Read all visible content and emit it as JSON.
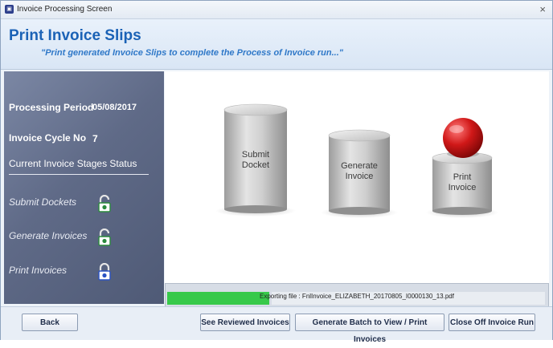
{
  "window": {
    "title": "Invoice Processing Screen",
    "app_icon": "app-icon",
    "close_glyph": "×"
  },
  "header": {
    "title": "Print Invoice Slips",
    "subtitle": "\"Print generated Invoice Slips to complete the Process of Invoice run...\""
  },
  "sidebar": {
    "processing_period_label": "Processing Period",
    "processing_period_value": "05/08/2017",
    "invoice_cycle_label": "Invoice Cycle No",
    "invoice_cycle_value": "7",
    "status_heading": "Current Invoice Stages Status",
    "stages": [
      {
        "label": "Submit Dockets",
        "icon": "unlocked-padlock-icon",
        "color": "#2a8a3c"
      },
      {
        "label": "Generate Invoices",
        "icon": "unlocked-padlock-icon",
        "color": "#2a8a3c"
      },
      {
        "label": "Print Invoices",
        "icon": "locked-padlock-icon",
        "color": "#2a53c4"
      }
    ]
  },
  "diagram": {
    "stages": [
      {
        "line1": "Submit",
        "line2": "Docket"
      },
      {
        "line1": "Generate",
        "line2": "Invoice"
      },
      {
        "line1": "Print",
        "line2": "Invoice"
      }
    ],
    "current_stage_marker": "red-ball-indicator",
    "marker_color": "#d01818"
  },
  "progress": {
    "text": "Exporting file : FnlInvoice_ELIZABETH_20170805_I0000130_13.pdf",
    "fraction": 0.27,
    "color": "#37c94a"
  },
  "buttons": {
    "back": "Back",
    "see_reviewed": "See Reviewed Invoices",
    "generate_batch": "Generate Batch to View / Print Invoices",
    "close_off": "Close Off Invoice Run"
  }
}
